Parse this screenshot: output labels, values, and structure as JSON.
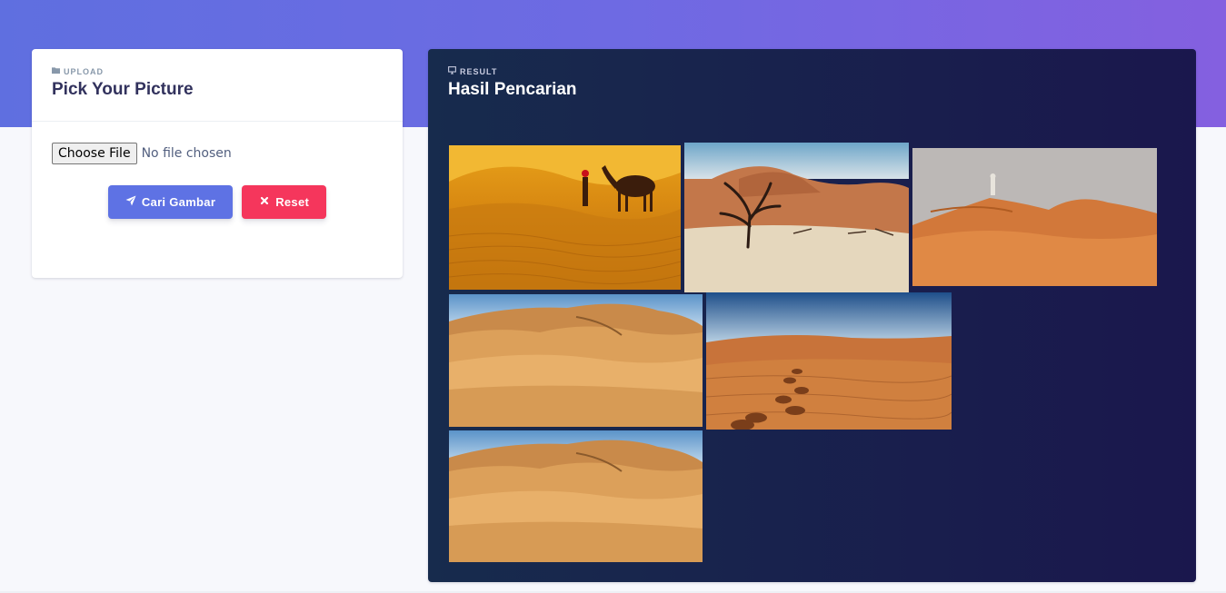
{
  "upload": {
    "eyebrow": "UPLOAD",
    "title": "Pick Your Picture",
    "file_button": "Choose File",
    "file_status": "No file chosen",
    "search_button": "Cari Gambar",
    "reset_button": "Reset"
  },
  "result": {
    "eyebrow": "RESULT",
    "title": "Hasil Pencarian",
    "images": [
      {
        "name": "desert-camel-image",
        "scene": "camel"
      },
      {
        "name": "desert-dead-tree-image",
        "scene": "tree"
      },
      {
        "name": "desert-person-dune-image",
        "scene": "person"
      },
      {
        "name": "desert-dunes-image",
        "scene": "dunes"
      },
      {
        "name": "desert-footprints-image",
        "scene": "footprints"
      },
      {
        "name": "desert-dunes-image-2",
        "scene": "dunes"
      }
    ]
  },
  "colors": {
    "primary": "#5e72e4",
    "danger": "#f5365c",
    "result_bg": "#172b4d",
    "title": "#32325d"
  },
  "icons": {
    "upload_eyebrow": "folder-icon",
    "result_eyebrow": "monitor-icon",
    "search_button": "paper-plane-icon",
    "reset_button": "close-icon"
  }
}
